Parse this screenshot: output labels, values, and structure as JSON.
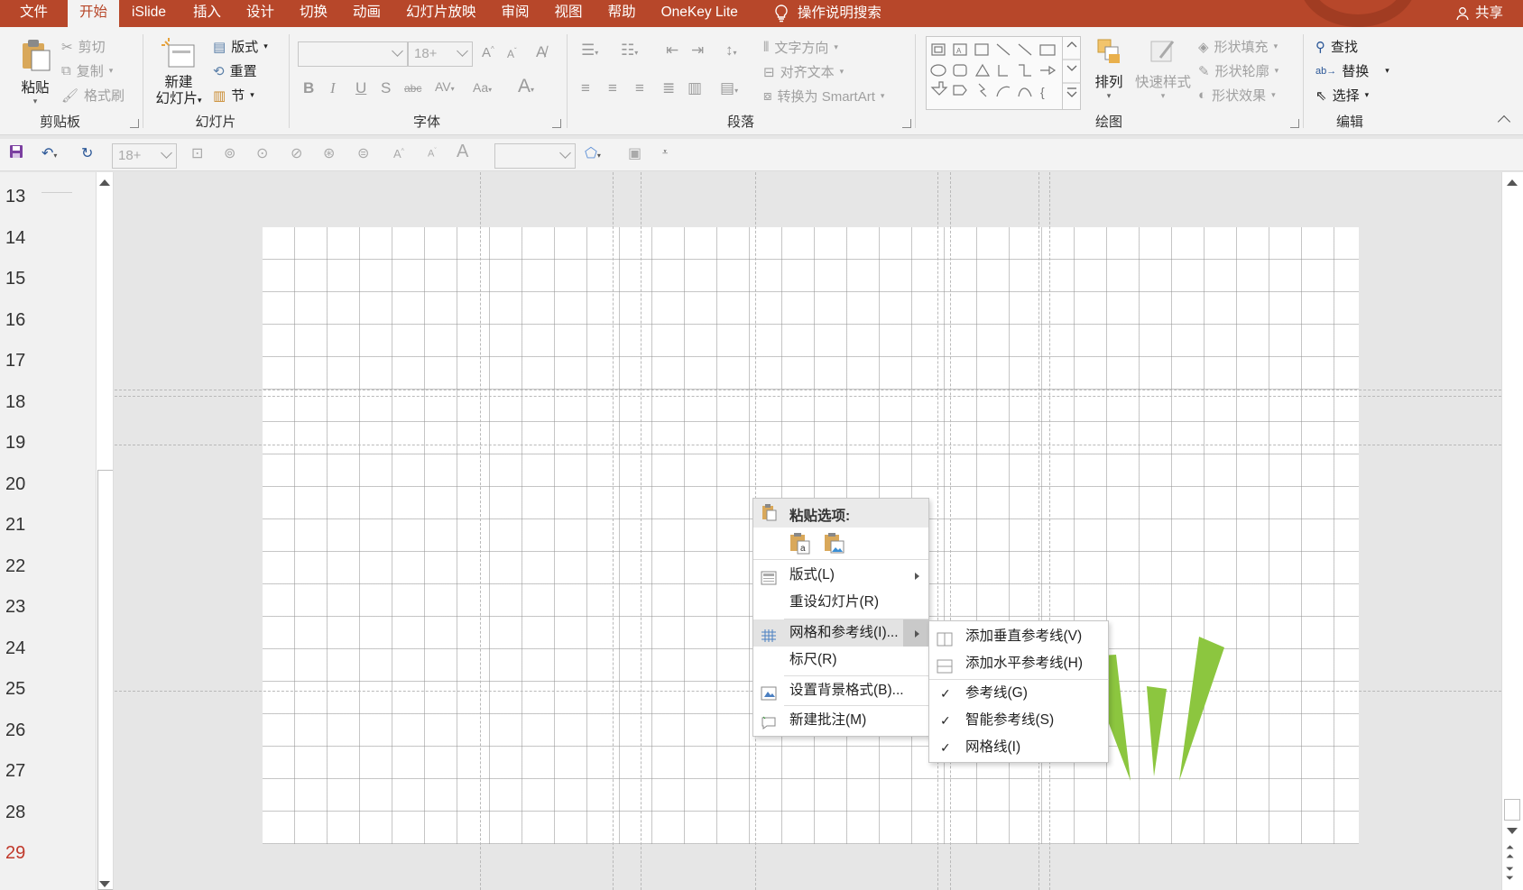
{
  "tabs": [
    "文件",
    "开始",
    "iSlide",
    "插入",
    "设计",
    "切换",
    "动画",
    "幻灯片放映",
    "审阅",
    "视图",
    "帮助",
    "OneKey Lite"
  ],
  "active_tab": "开始",
  "search_label": "操作说明搜索",
  "share_label": "共享",
  "ribbon": {
    "clipboard": {
      "paste": "粘贴",
      "cut": "剪切",
      "copy": "复制",
      "format_painter": "格式刷",
      "label": "剪贴板"
    },
    "slides": {
      "new_slide_line1": "新建",
      "new_slide_line2": "幻灯片",
      "layout": "版式",
      "reset": "重置",
      "section": "节",
      "label": "幻灯片"
    },
    "font": {
      "font_size": "18+",
      "label": "字体"
    },
    "paragraph": {
      "text_direction": "文字方向",
      "align_text": "对齐文本",
      "smartart": "转换为 SmartArt",
      "label": "段落"
    },
    "drawing": {
      "arrange": "排列",
      "quick_styles": "快速样式",
      "shape_fill": "形状填充",
      "shape_outline": "形状轮廓",
      "shape_effects": "形状效果",
      "label": "绘图"
    },
    "editing": {
      "find": "查找",
      "replace": "替换",
      "select": "选择",
      "label": "编辑"
    }
  },
  "qat": {
    "font_size": "18+"
  },
  "line_numbers": [
    "13",
    "14",
    "15",
    "16",
    "17",
    "18",
    "19",
    "20",
    "21",
    "22",
    "23",
    "24",
    "25",
    "26",
    "27",
    "28",
    "29"
  ],
  "context_menu": {
    "paste_header": "粘贴选项:",
    "items": [
      "版式(L)",
      "重设幻灯片(R)",
      "网格和参考线(I)...",
      "标尺(R)",
      "设置背景格式(B)...",
      "新建批注(M)"
    ]
  },
  "submenu": {
    "items": [
      {
        "label": "添加垂直参考线(V)",
        "checked": false
      },
      {
        "label": "添加水平参考线(H)",
        "checked": false
      },
      {
        "label": "参考线(G)",
        "checked": true
      },
      {
        "label": "智能参考线(S)",
        "checked": true
      },
      {
        "label": "网格线(I)",
        "checked": true
      }
    ]
  },
  "colors": {
    "accent": "#b7472a",
    "spike_green": "#8cc63f"
  }
}
